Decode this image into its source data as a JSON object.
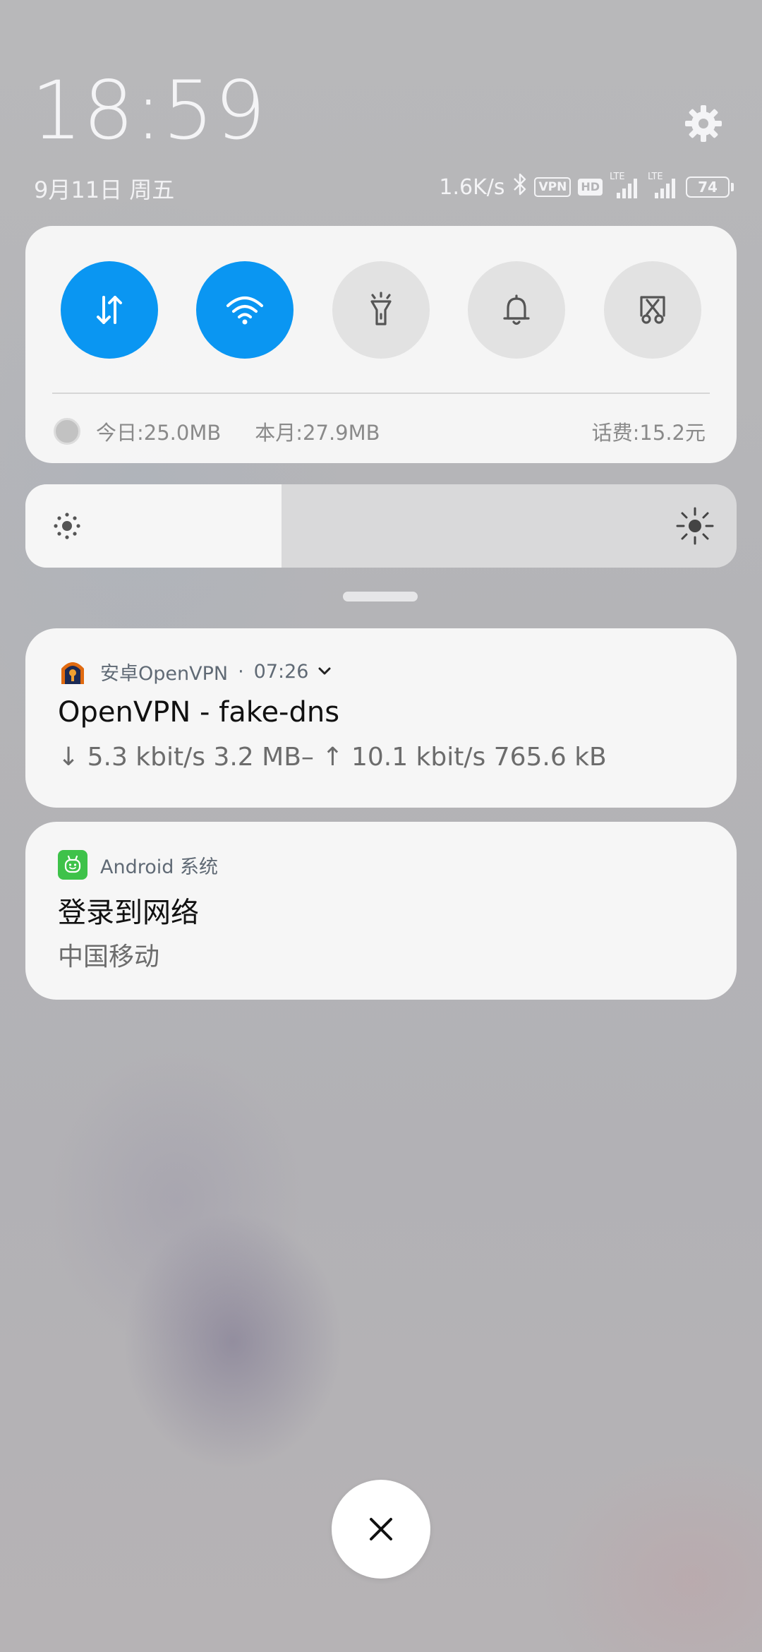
{
  "header": {
    "time": "18:59",
    "date": "9月11日 周五"
  },
  "status_bar": {
    "speed": "1.6K/s",
    "vpn_label": "VPN",
    "hd_label": "HD",
    "lte1_label": "LTE",
    "lte2_label": "LTE",
    "battery": "74",
    "icons": [
      "bluetooth-icon",
      "vpn-icon",
      "hd-icon",
      "signal-icon",
      "signal-icon",
      "battery-icon"
    ]
  },
  "quick_settings": {
    "toggles": [
      {
        "name": "mobile-data",
        "icon": "mobile-data-icon",
        "on": true
      },
      {
        "name": "wifi",
        "icon": "wifi-icon",
        "on": true
      },
      {
        "name": "flashlight",
        "icon": "flashlight-icon",
        "on": false
      },
      {
        "name": "sound",
        "icon": "bell-icon",
        "on": false
      },
      {
        "name": "screenshot",
        "icon": "screenshot-icon",
        "on": false
      }
    ],
    "usage": {
      "today": "今日:25.0MB",
      "month": "本月:27.9MB",
      "fee": "话费:15.2元"
    }
  },
  "brightness": {
    "level": 0.36
  },
  "notifications": [
    {
      "app": "安卓OpenVPN",
      "separator": "·",
      "time": "07:26",
      "title": "OpenVPN - fake-dns",
      "body": "↓ 5.3 kbit/s 3.2 MB– ↑ 10.1 kbit/s 765.6 kB"
    },
    {
      "app": "Android 系统",
      "title": "登录到网络",
      "body": "中国移动"
    }
  ],
  "colors": {
    "accent": "#0a96f2",
    "toggle_off": "#e2e2e2",
    "android_icon": "#3ec24a"
  }
}
